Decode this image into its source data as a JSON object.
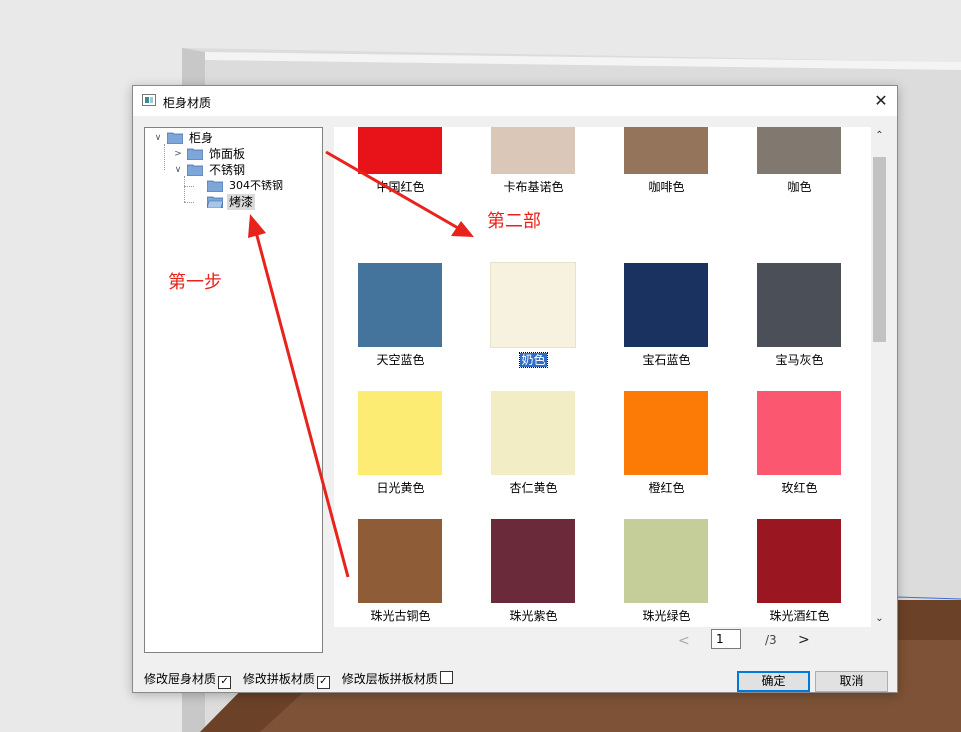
{
  "dialog": {
    "title": "柜身材质",
    "close_symbol": "✕"
  },
  "tree": {
    "nodes": [
      {
        "label": "柜身",
        "expanded": true
      },
      {
        "label": "饰面板",
        "expanded": false
      },
      {
        "label": "不锈钢",
        "expanded": true
      },
      {
        "label": "304不锈钢"
      },
      {
        "label": "烤漆",
        "selected": true
      }
    ]
  },
  "materials": [
    {
      "label": "中国红色",
      "color": "#e81318"
    },
    {
      "label": "卡布基诺色",
      "color": "#dbc7b8"
    },
    {
      "label": "咖啡色",
      "color": "#94755c"
    },
    {
      "label": "咖色",
      "color": "#81786f"
    },
    {
      "label": "天空蓝色",
      "color": "#44749c"
    },
    {
      "label": "奶色",
      "color": "#f7f1df",
      "selected": true
    },
    {
      "label": "宝石蓝色",
      "color": "#19325f"
    },
    {
      "label": "宝马灰色",
      "color": "#4a4f58"
    },
    {
      "label": "日光黄色",
      "color": "#fdec74"
    },
    {
      "label": "杏仁黄色",
      "color": "#f3edc6"
    },
    {
      "label": "橙红色",
      "color": "#fc7b07"
    },
    {
      "label": "玫红色",
      "color": "#fc5770"
    },
    {
      "label": "珠光古铜色",
      "color": "#8e5d37"
    },
    {
      "label": "珠光紫色",
      "color": "#6a2a3a"
    },
    {
      "label": "珠光绿色",
      "color": "#c5ce99"
    },
    {
      "label": "珠光酒红色",
      "color": "#9a1621"
    },
    {
      "label": "",
      "color": "#444444"
    },
    {
      "label": "",
      "color": "#a9a9a9"
    },
    {
      "label": "",
      "color": "#b8aa8f"
    },
    {
      "label": "",
      "color": "#ecdcc6"
    }
  ],
  "pager": {
    "prev": "<",
    "current": "1",
    "total": "/3",
    "next": ">"
  },
  "options": [
    {
      "label": "修改屉身材质",
      "checked": true
    },
    {
      "label": "修改拼板材质",
      "checked": true
    },
    {
      "label": "修改层板拼板材质",
      "checked": false
    }
  ],
  "buttons": {
    "ok": "确定",
    "cancel": "取消"
  },
  "annotations": {
    "step1": "第一步",
    "step2": "第二部"
  },
  "colors": {
    "annotation_red": "#e8231c",
    "selection_blue": "#2f6fc8"
  }
}
